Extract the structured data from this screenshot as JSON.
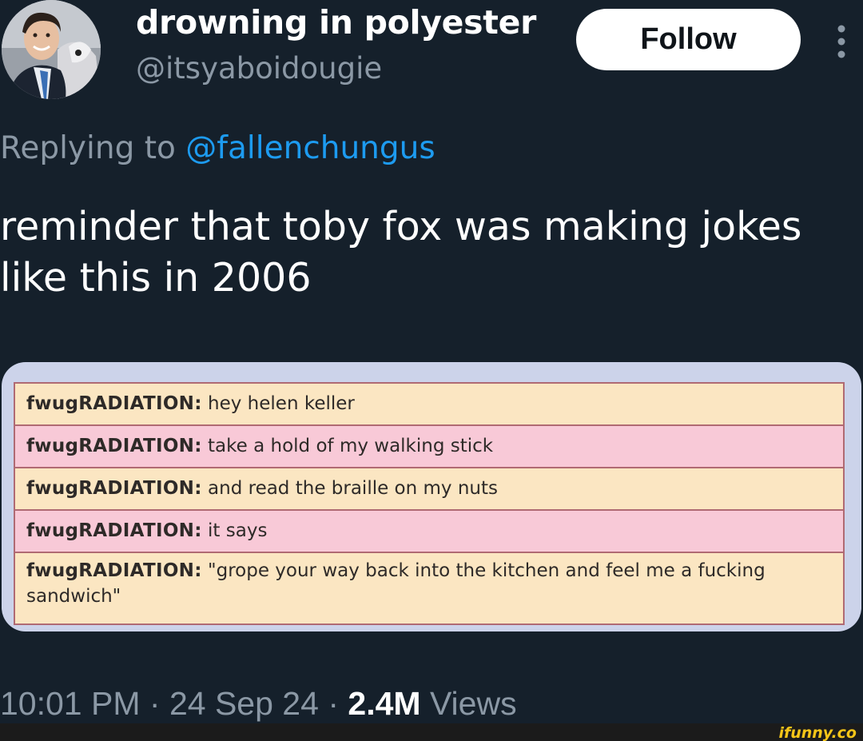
{
  "tweet": {
    "display_name": "drowning in polyester",
    "handle": "@itsyaboidougie",
    "follow_label": "Follow",
    "reply_prefix": "Replying to",
    "reply_to": "@fallenchungus",
    "text": "reminder that toby fox was making jokes like this in 2006"
  },
  "chat": {
    "rows": [
      {
        "user": "fwugRADIATION:",
        "message": "hey helen keller"
      },
      {
        "user": "fwugRADIATION:",
        "message": "take a hold of my walking stick"
      },
      {
        "user": "fwugRADIATION:",
        "message": "and read the braille on my nuts"
      },
      {
        "user": "fwugRADIATION:",
        "message": "it says"
      },
      {
        "user": "fwugRADIATION:",
        "message": "\"grope your way back into the kitchen and feel me a fucking sandwich\""
      }
    ],
    "row_colors": [
      "#fbe6c2",
      "#f8c9d7",
      "#fbe6c2",
      "#f8c9d7",
      "#fbe6c2"
    ]
  },
  "meta": {
    "time": "10:01 PM",
    "separator": "·",
    "date": "24 Sep 24",
    "views_count": "2.4M",
    "views_label": "Views"
  },
  "watermark": {
    "text": "ifunny.co",
    "color": "#f5c518"
  }
}
